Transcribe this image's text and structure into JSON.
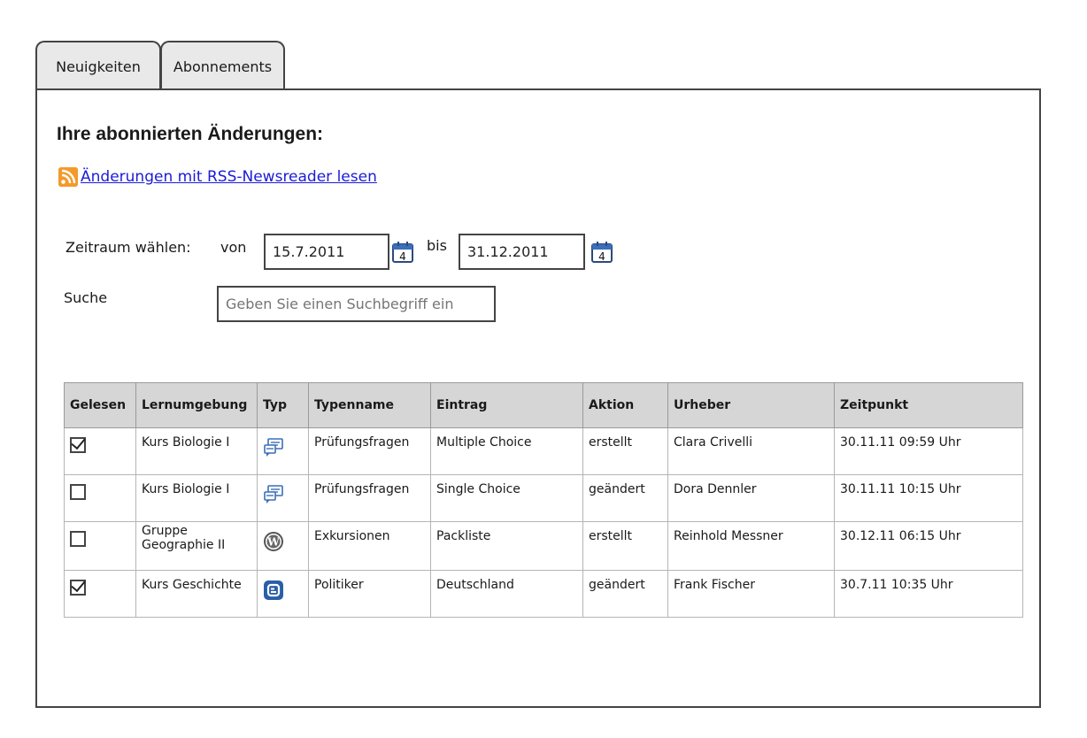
{
  "tabs": [
    {
      "label": "Neuigkeiten",
      "active": false
    },
    {
      "label": "Abonnements",
      "active": true
    }
  ],
  "page_title": "Ihre abonnierten Änderungen:",
  "rss_link": {
    "text": "Änderungen mit RSS-Newsreader lesen",
    "icon": "rss-icon"
  },
  "filter": {
    "zeitraum_label": "Zeitraum wählen:",
    "von_label": "von",
    "von_value": "15.7.2011",
    "bis_label": "bis",
    "bis_value": "31.12.2011",
    "calendar_icon_day": "4",
    "suche_label": "Suche",
    "suche_placeholder": "Geben Sie einen Suchbegriff ein"
  },
  "table": {
    "headers": [
      "Gelesen",
      "Lernumgebung",
      "Typ",
      "Typenname",
      "Eintrag",
      "Aktion",
      "Urheber",
      "Zeitpunkt"
    ],
    "rows": [
      {
        "gelesen": true,
        "lernumgebung": "Kurs Biologie I",
        "typ_icon": "forum-icon",
        "typenname": "Prüfungsfragen",
        "eintrag": "Multiple Choice",
        "aktion": "erstellt",
        "urheber": "Clara Crivelli",
        "zeitpunkt": "30.11.11 09:59 Uhr"
      },
      {
        "gelesen": false,
        "lernumgebung": "Kurs Biologie I",
        "typ_icon": "forum-icon",
        "typenname": "Prüfungsfragen",
        "eintrag": "Single Choice",
        "aktion": "geändert",
        "urheber": "Dora Dennler",
        "zeitpunkt": "30.11.11 10:15 Uhr"
      },
      {
        "gelesen": false,
        "lernumgebung": "Gruppe Geographie II",
        "typ_icon": "wordpress-icon",
        "typenname": "Exkursionen",
        "eintrag": "Packliste",
        "aktion": "erstellt",
        "urheber": "Reinhold Messner",
        "zeitpunkt": "30.12.11 06:15 Uhr"
      },
      {
        "gelesen": true,
        "lernumgebung": "Kurs Geschichte",
        "typ_icon": "blogger-icon",
        "typenname": "Politiker",
        "eintrag": "Deutschland",
        "aktion": "geändert",
        "urheber": "Frank Fischer",
        "zeitpunkt": "30.7.11 10:35 Uhr"
      }
    ]
  },
  "colors": {
    "link": "#1b1bd8",
    "rss": "#f39a2b",
    "header_bg": "#d6d6d6",
    "blogger": "#2a5fa8",
    "forum": "#3b6fb8"
  }
}
